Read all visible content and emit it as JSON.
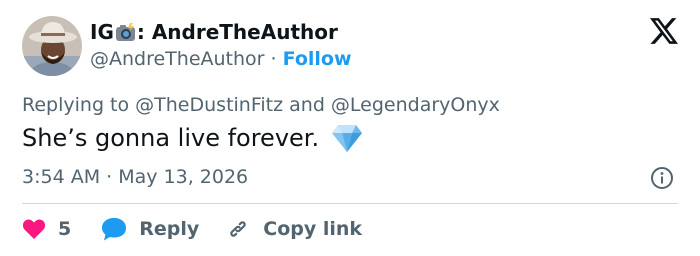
{
  "author": {
    "display_name_prefix": "IG",
    "display_name_suffix": ": AndreTheAuthor",
    "handle": "@AndreTheAuthor",
    "separator": " · ",
    "follow_label": "Follow"
  },
  "reply_context": {
    "prefix": "Replying to ",
    "mention_1": "@TheDustinFitz",
    "joiner": " and ",
    "mention_2": "@LegendaryOnyx"
  },
  "tweet": {
    "text": "She’s gonna live forever.",
    "emoji": "gem-stone-icon",
    "timestamp": "3:54 AM · May 13, 2026"
  },
  "actions": {
    "like_count": "5",
    "reply_label": "Reply",
    "copy_link_label": "Copy link"
  },
  "icons": {
    "brand_logo": "x-logo-icon",
    "camera": "camera-with-flash-icon",
    "info": "info-icon",
    "like": "heart-icon",
    "reply": "speech-bubble-icon",
    "copy": "link-icon"
  },
  "colors": {
    "text_primary": "#0f1419",
    "text_secondary": "#536471",
    "link_blue": "#1d9bf0",
    "like_pink": "#f91880",
    "reply_blue": "#1d9bf0",
    "divider": "#cfd9de"
  }
}
